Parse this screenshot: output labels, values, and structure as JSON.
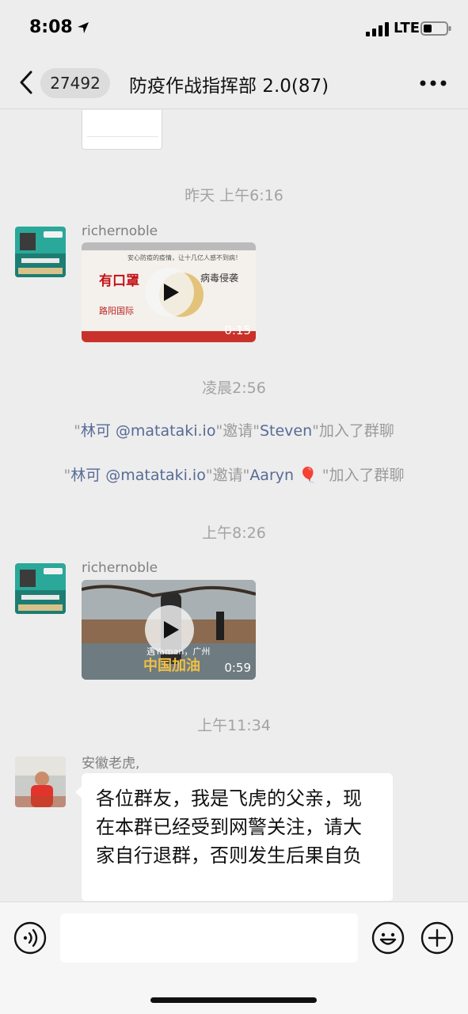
{
  "status_bar": {
    "time": "8:08",
    "network": "LTE"
  },
  "header": {
    "unread_count": "27492",
    "title": "防疫作战指挥部 2.0(87)"
  },
  "messages": {
    "sep1": "昨天 上午6:16",
    "m1_sender": "richernoble",
    "m1_duration": "0:15",
    "m1_video_headline": "有口罩",
    "m1_video_side": "病毒侵袭",
    "m1_video_top": "安心防疫的疫情，让十几亿人感不到病！",
    "m1_video_brand": "路阳国际",
    "sep2": "凌晨2:56",
    "sys1": {
      "q1": "\"",
      "inviter": "林可 @matataki.io",
      "q2": "\"邀请\"",
      "invitee": "Steven",
      "q3": "\"加入了群聊"
    },
    "sys2": {
      "q1": "\"",
      "inviter": "林可 @matataki.io",
      "q2": "\"邀请\"",
      "invitee": "Aaryn 🎈",
      "q3": " \"加入了群聊"
    },
    "sep3": "上午8:26",
    "m2_sender": "richernoble",
    "m2_duration": "0:59",
    "m2_caption": "中国加油",
    "m2_subcaption": "遇Yaman，广州",
    "sep4": "上午11:34",
    "m3_sender": "安徽老虎,",
    "m3_text": "各位群友，我是飞虎的父亲，现在本群已经受到网警关注，请大家自行退群，否则发生后果自负"
  },
  "input": {
    "value": ""
  },
  "icons": {
    "back": "chevron-left-icon",
    "more": "more-icon",
    "voice": "voice-icon",
    "emoji": "emoji-icon",
    "plus": "plus-icon",
    "play": "play-icon"
  }
}
